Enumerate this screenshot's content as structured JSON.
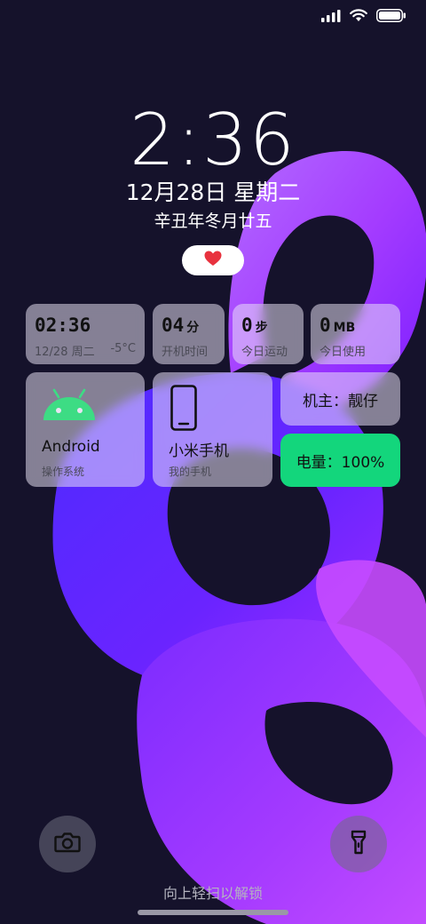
{
  "status_bar": {
    "signal_icon": "signal-bars-icon",
    "wifi_icon": "wifi-icon",
    "battery_icon": "battery-icon"
  },
  "lockscreen": {
    "time": "2:36",
    "date": "12月28日 星期二",
    "lunar_date": "辛丑年冬月廿五",
    "heart_icon": "heart-icon"
  },
  "widgets": {
    "clock_widget": {
      "time": "02:36",
      "date": "12/28 周二",
      "temperature": "-5°C"
    },
    "uptime": {
      "value": "04",
      "unit": "分",
      "label": "开机时间"
    },
    "steps": {
      "value": "0",
      "unit": "步",
      "label": "今日运动"
    },
    "data_usage": {
      "value": "0",
      "unit": "MB",
      "label": "今日使用"
    },
    "os": {
      "name": "Android",
      "label": "操作系统",
      "icon": "android-icon"
    },
    "device": {
      "name": "小米手机",
      "label": "我的手机",
      "icon": "phone-icon"
    },
    "owner": {
      "text": "机主：靓仔"
    },
    "battery": {
      "text": "电量：100%"
    }
  },
  "bottom": {
    "camera_icon": "camera-icon",
    "flashlight_icon": "flashlight-icon",
    "unlock_hint": "向上轻扫以解锁"
  },
  "colors": {
    "background": "#15122b",
    "battery_widget": "#13d67c",
    "android_green": "#3ddc84",
    "heart_red": "#e8323e"
  }
}
